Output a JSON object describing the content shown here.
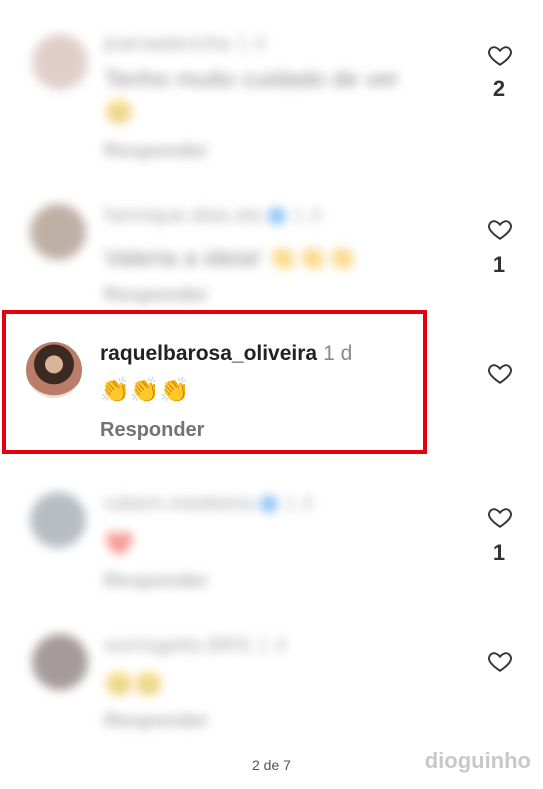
{
  "comments": [
    {
      "username": "joanaatencha",
      "time": "1 d",
      "text": "Tenho muito cuidado de ver",
      "emoji": "😊",
      "reply": "Responder",
      "likes": "2",
      "blurred": true
    },
    {
      "username": "henrique.dias.etc",
      "time": "1 d",
      "text": "Valeria a ideia!",
      "emoji": "👏👏👏",
      "reply": "Responder",
      "likes": "1",
      "blurred": true
    },
    {
      "username": "raquelbarosa_oliveira",
      "time": "1 d",
      "text": "👏👏👏",
      "reply": "Responder",
      "likes": "",
      "blurred": false
    },
    {
      "username": "rubem.medeiros",
      "time": "1 d",
      "text": "❤️",
      "reply": "Responder",
      "likes": "1",
      "blurred": true
    },
    {
      "username": "sorrisgetto.BRS",
      "time": "1 d",
      "text": "😊😊",
      "reply": "Responder",
      "likes": "",
      "blurred": true
    }
  ],
  "footer": {
    "page_indicator": "2 de 7",
    "watermark": "dioguinho"
  },
  "colors": {
    "highlight": "#e3000f",
    "reply_gray": "#737373",
    "verified": "#3897f0"
  },
  "icons": {
    "like": "heart-outline-icon"
  }
}
